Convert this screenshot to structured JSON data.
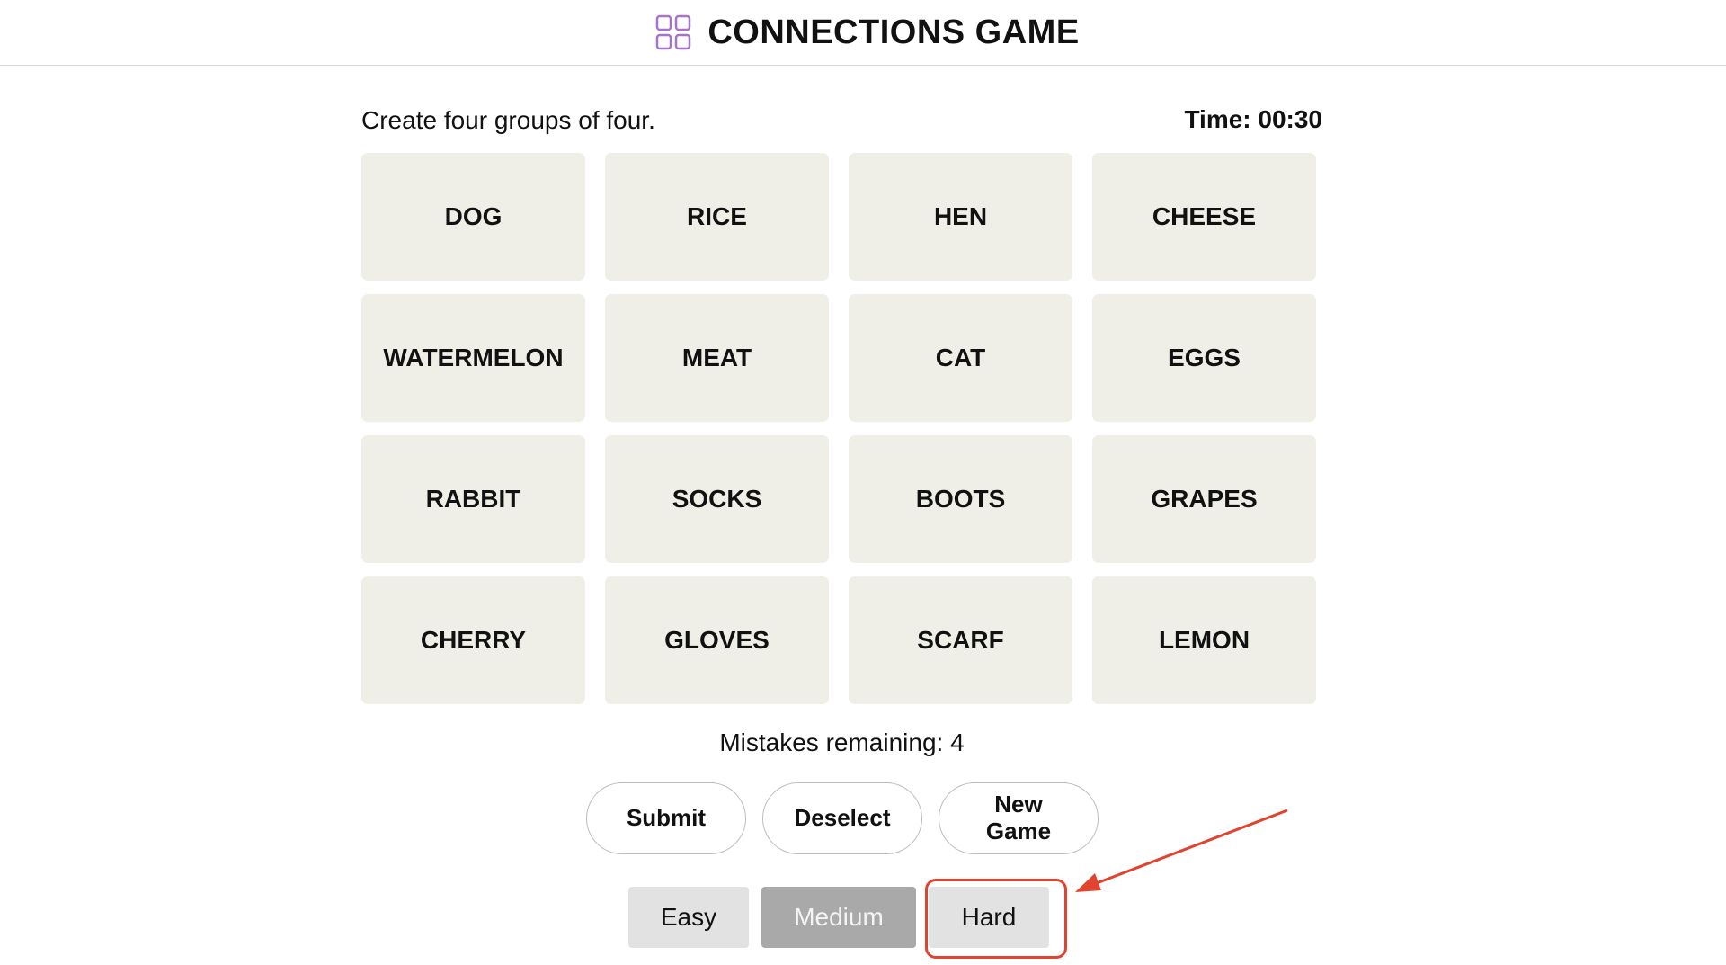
{
  "header": {
    "title": "CONNECTIONS GAME",
    "logo_icon": "grid-2x2-icon",
    "logo_color": "#a874c9"
  },
  "game": {
    "instruction": "Create four groups of four.",
    "timer": "Time: 00:30",
    "tiles": [
      "DOG",
      "RICE",
      "HEN",
      "CHEESE",
      "WATERMELON",
      "MEAT",
      "CAT",
      "EGGS",
      "RABBIT",
      "SOCKS",
      "BOOTS",
      "GRAPES",
      "CHERRY",
      "GLOVES",
      "SCARF",
      "LEMON"
    ],
    "mistakes": "Mistakes remaining: 4"
  },
  "actions": {
    "submit": "Submit",
    "deselect": "Deselect",
    "new_game": "New Game"
  },
  "difficulty": {
    "easy": "Easy",
    "medium": "Medium",
    "hard": "Hard",
    "selected": "Medium"
  },
  "annotation": {
    "color": "#e0432f",
    "target": "Hard"
  },
  "colors": {
    "tile_bg": "#efefe8",
    "selected_difficulty_bg": "#a9a9a9",
    "difficulty_bg": "#e2e2e2"
  }
}
